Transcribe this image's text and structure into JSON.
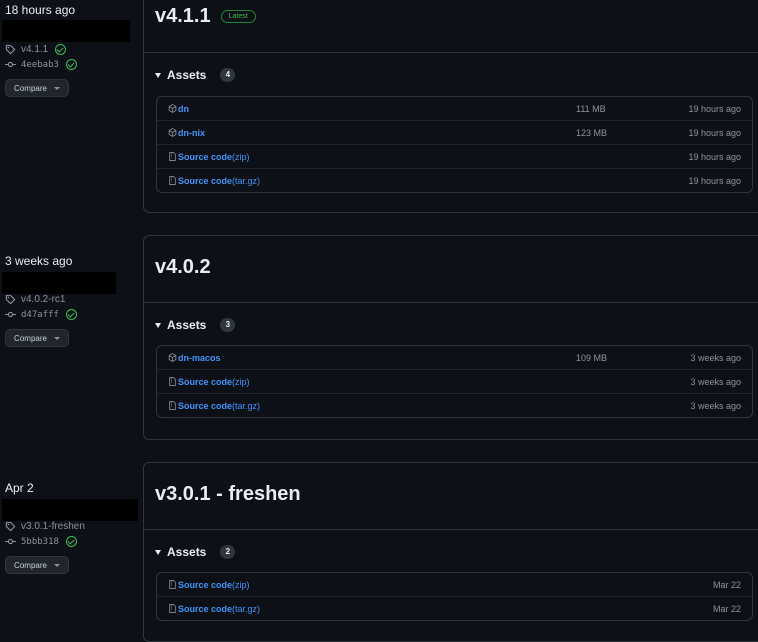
{
  "releases": [
    {
      "when": "18 hours ago",
      "tag": "v4.1.1",
      "tag_verified": true,
      "commit": "4eebab3",
      "commit_verified": true,
      "compare_label": "Compare",
      "title": "v4.1.1",
      "badge": "Latest",
      "assets_label": "Assets",
      "assets_count": "4",
      "assets": [
        {
          "icon": "package-icon",
          "name": "dn",
          "suffix": "",
          "size": "111 MB",
          "date": "19 hours ago"
        },
        {
          "icon": "package-icon",
          "name": "dn-nix",
          "suffix": "",
          "size": "123 MB",
          "date": "19 hours ago"
        },
        {
          "icon": "file-zip-icon",
          "name": "Source code",
          "suffix": " (zip)",
          "size": "",
          "date": "19 hours ago"
        },
        {
          "icon": "file-zip-icon",
          "name": "Source code",
          "suffix": " (tar.gz)",
          "size": "",
          "date": "19 hours ago"
        }
      ]
    },
    {
      "when": "3 weeks ago",
      "tag": "v4.0.2-rc1",
      "tag_verified": false,
      "commit": "d47afff",
      "commit_verified": true,
      "compare_label": "Compare",
      "title": "v4.0.2",
      "badge": "",
      "assets_label": "Assets",
      "assets_count": "3",
      "assets": [
        {
          "icon": "package-icon",
          "name": "dn-macos",
          "suffix": "",
          "size": "109 MB",
          "date": "3 weeks ago"
        },
        {
          "icon": "file-zip-icon",
          "name": "Source code",
          "suffix": " (zip)",
          "size": "",
          "date": "3 weeks ago"
        },
        {
          "icon": "file-zip-icon",
          "name": "Source code",
          "suffix": " (tar.gz)",
          "size": "",
          "date": "3 weeks ago"
        }
      ]
    },
    {
      "when": "Apr 2",
      "tag": "v3.0.1-freshen",
      "tag_verified": false,
      "commit": "5bbb318",
      "commit_verified": true,
      "compare_label": "Compare",
      "title": "v3.0.1 - freshen",
      "badge": "",
      "assets_label": "Assets",
      "assets_count": "2",
      "assets": [
        {
          "icon": "file-zip-icon",
          "name": "Source code",
          "suffix": " (zip)",
          "size": "",
          "date": "Mar 22"
        },
        {
          "icon": "file-zip-icon",
          "name": "Source code",
          "suffix": " (tar.gz)",
          "size": "",
          "date": "Mar 22"
        }
      ]
    }
  ]
}
